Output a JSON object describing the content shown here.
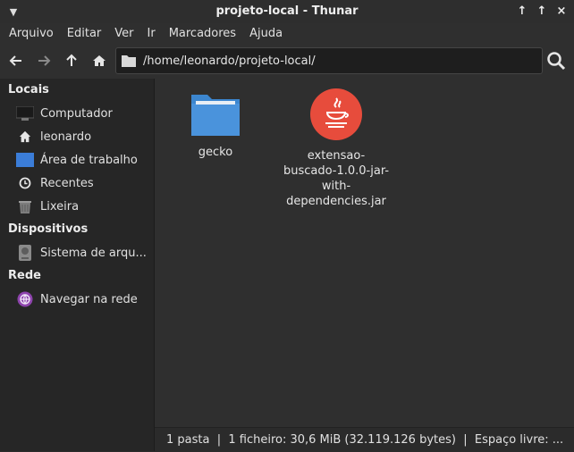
{
  "window": {
    "title": "projeto-local - Thunar",
    "buttons": [
      "minimize-icon",
      "maximize-icon",
      "close-icon"
    ]
  },
  "menubar": [
    "Arquivo",
    "Editar",
    "Ver",
    "Ir",
    "Marcadores",
    "Ajuda"
  ],
  "toolbar": {
    "path": "/home/leonardo/projeto-local/"
  },
  "sidebar": {
    "sections": [
      {
        "title": "Locais",
        "items": [
          {
            "label": "Computador",
            "icon": "computer-icon"
          },
          {
            "label": "leonardo",
            "icon": "home-icon"
          },
          {
            "label": "Área de trabalho",
            "icon": "desktop-icon"
          },
          {
            "label": "Recentes",
            "icon": "clock-icon"
          },
          {
            "label": "Lixeira",
            "icon": "trash-icon"
          }
        ]
      },
      {
        "title": "Dispositivos",
        "items": [
          {
            "label": "Sistema de arqu...",
            "icon": "drive-icon"
          }
        ]
      },
      {
        "title": "Rede",
        "items": [
          {
            "label": "Navegar na rede",
            "icon": "network-icon"
          }
        ]
      }
    ]
  },
  "files": [
    {
      "name_lines": [
        "gecko"
      ],
      "icon": "folder-icon"
    },
    {
      "name_lines": [
        "extensao-",
        "buscado-1.0.0-jar-",
        "with-",
        "dependencies.jar"
      ],
      "icon": "java-icon"
    }
  ],
  "status": "1 pasta  |  1 ficheiro: 30,6 MiB (32.119.126 bytes)  |  Espaço livre: ..."
}
